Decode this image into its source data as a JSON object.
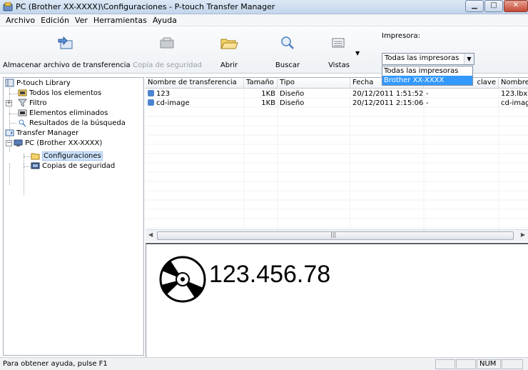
{
  "window": {
    "title": "PC (Brother XX-XXXX)\\Configuraciones - P-touch Transfer Manager",
    "controls": [
      "minimize",
      "maximize",
      "close"
    ]
  },
  "menu": [
    "Archivo",
    "Edición",
    "Ver",
    "Herramientas",
    "Ayuda"
  ],
  "toolbar": {
    "buttons": [
      {
        "label": "Almacenar archivo de transferencia",
        "icon": "transfer-store-icon",
        "enabled": true
      },
      {
        "label": "Copia de seguridad",
        "icon": "backup-icon",
        "enabled": false
      },
      {
        "label": "Abrir",
        "icon": "open-folder-icon",
        "enabled": true
      },
      {
        "label": "Buscar",
        "icon": "search-icon",
        "enabled": true
      },
      {
        "label": "Vistas",
        "icon": "views-icon",
        "enabled": true
      }
    ],
    "printer_label": "Impresora:",
    "printer_selected": "Todas las impresoras",
    "printer_options": [
      "Todas las impresoras",
      "Brother XX-XXXX"
    ]
  },
  "tree": {
    "items": [
      {
        "label": "P-touch Library",
        "icon": "library-icon"
      },
      {
        "label": "Todos los elementos",
        "icon": "all-items-icon"
      },
      {
        "label": "Filtro",
        "icon": "filter-icon"
      },
      {
        "label": "Elementos eliminados",
        "icon": "deleted-items-icon"
      },
      {
        "label": "Resultados de la búsqueda",
        "icon": "search-results-icon"
      },
      {
        "label": "Transfer Manager",
        "icon": "transfer-manager-icon"
      },
      {
        "label": "PC (Brother XX-XXXX)",
        "icon": "pc-icon"
      },
      {
        "label": "Configuraciones",
        "icon": "configurations-folder-icon",
        "selected": true
      },
      {
        "label": "Copias de seguridad",
        "icon": "backups-folder-icon"
      }
    ]
  },
  "table": {
    "columns": [
      "Nombre de transferencia",
      "Tamaño",
      "Tipo",
      "Fecha",
      "clave",
      "Nombre"
    ],
    "rows": [
      {
        "name": "123",
        "size": "1KB",
        "type": "Diseño",
        "date": "20/12/2011 1:51:52",
        "key": "-",
        "file": "123.lbx"
      },
      {
        "name": "cd-image",
        "size": "1KB",
        "type": "Diseño",
        "date": "20/12/2011 2:15:06",
        "key": "-",
        "file": "cd-imag"
      }
    ]
  },
  "preview": {
    "text": "123.456.78",
    "icon": "cd-disc-icon"
  },
  "status": {
    "message": "Para obtener ayuda, pulse F1",
    "num": "NUM"
  },
  "colors": {
    "selection": "#3399ff",
    "tree_selection": "#cfe3fb"
  }
}
